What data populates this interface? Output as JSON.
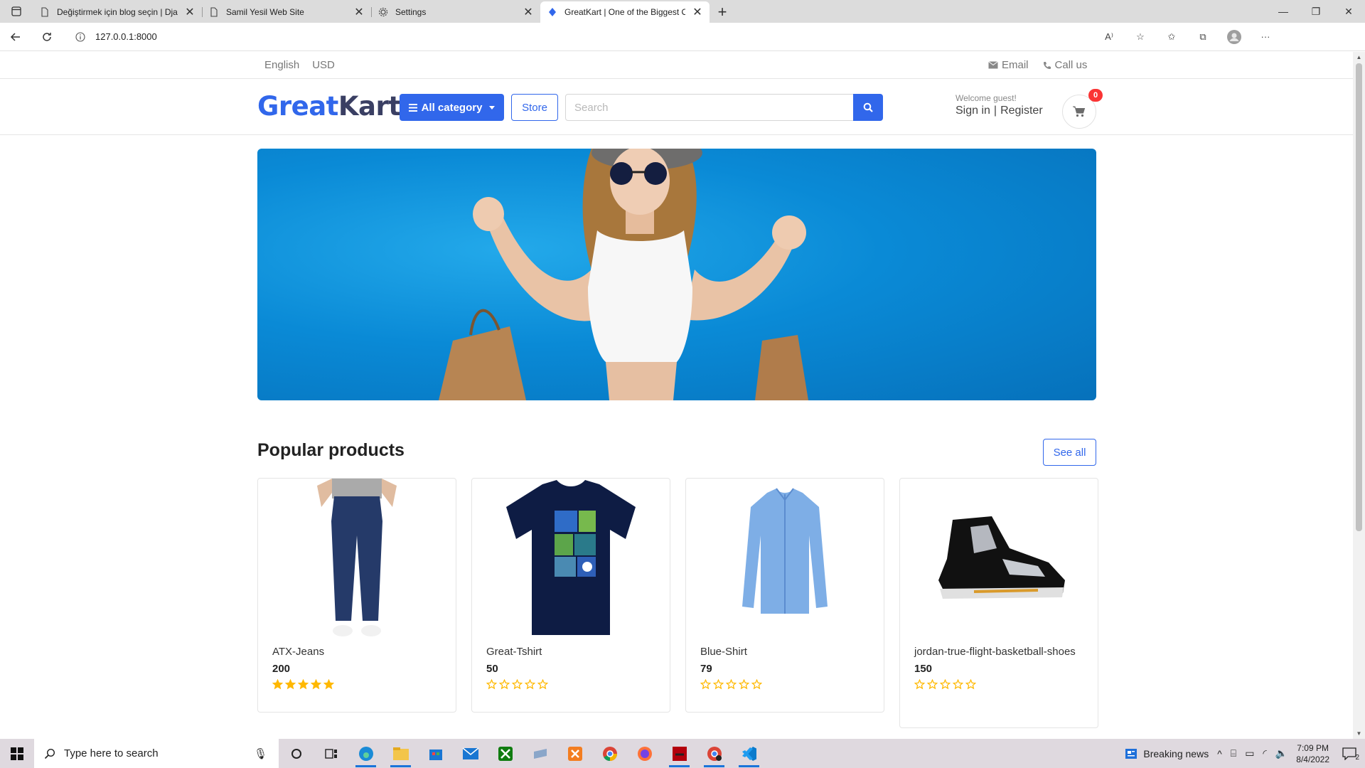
{
  "browser": {
    "tabs": [
      {
        "title": "Değiştirmek için blog seçin | Django",
        "active": false
      },
      {
        "title": "Samil Yesil Web Site",
        "active": false
      },
      {
        "title": "Settings",
        "active": false
      },
      {
        "title": "GreatKart | One of the Biggest Online Shopping Platform",
        "active": true
      }
    ],
    "url": "127.0.0.1:8000"
  },
  "site": {
    "topbar": {
      "language": "English",
      "currency": "USD",
      "email": "Email",
      "call": "Call us"
    },
    "logo": {
      "part1": "Great",
      "part2": "Kart"
    },
    "category_button": "All category",
    "store_button": "Store",
    "search_placeholder": "Search",
    "welcome": "Welcome guest!",
    "sign_in": "Sign in",
    "separator": "|",
    "register": "Register",
    "cart_count": "0",
    "section_title": "Popular products",
    "see_all": "See all",
    "products": [
      {
        "name": "ATX-Jeans",
        "price": "200",
        "rating": 5
      },
      {
        "name": "Great-Tshirt",
        "price": "50",
        "rating": 0
      },
      {
        "name": "Blue-Shirt",
        "price": "79",
        "rating": 0
      },
      {
        "name": "jordan-true-flight-basketball-shoes",
        "price": "150",
        "rating": 0
      }
    ],
    "colors": {
      "primary": "#3167eb",
      "star": "#ffb800",
      "badge": "#fa3434"
    }
  },
  "taskbar": {
    "search_placeholder": "Type here to search",
    "news": "Breaking news",
    "time": "7:09 PM",
    "date": "8/4/2022",
    "notifications": "2"
  }
}
